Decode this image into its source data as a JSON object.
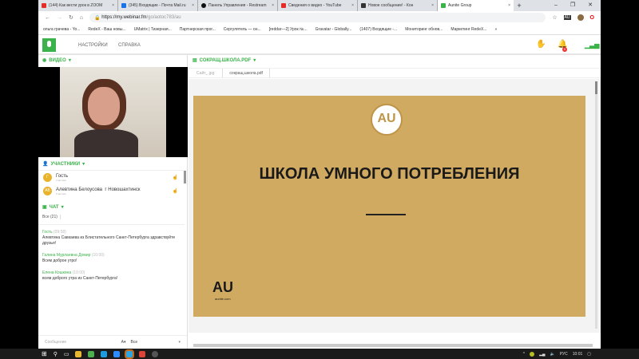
{
  "browser": {
    "tabs": [
      {
        "label": "(144) Как вести урок в ZOOM",
        "color": "#e52d27"
      },
      {
        "label": "(345) Входящие - Почта Mail.ru",
        "color": "#1a73e8"
      },
      {
        "label": "Панель Управления - Restream",
        "color": "#111111"
      },
      {
        "label": "Сведения о видео - YouTube",
        "color": "#e52d27"
      },
      {
        "label": "Новое сообщение! - Кон",
        "color": "#333333"
      },
      {
        "label": "Aunite Group",
        "color": "#3bb34a"
      }
    ],
    "url_host": "https://my.webinar.fm",
    "url_path": "/go/aotoc783/au",
    "bookmarks": [
      "ольга грачева - Yo...",
      "RedeX - Ваш новы...",
      "UMatrix | Тизерная...",
      "Партнерская прог...",
      "Сергулятель — он...",
      "[reddar—2] Урок №...",
      "Gravatar - Globally...",
      "(1407) Входящие -...",
      "Мониторинг обнов...",
      "Маркетинг RedeX..."
    ]
  },
  "app": {
    "menu": [
      "НАСТРОЙКИ",
      "СПРАВКА"
    ],
    "notification_count": "0"
  },
  "video": {
    "label": "ВИДЕО"
  },
  "participants": {
    "label": "УЧАСТНИКИ",
    "items": [
      {
        "initial": "Г",
        "name": "Гость",
        "role": "Участник",
        "city": ""
      },
      {
        "initial": "АБ",
        "name": "Алевтина Белоусова",
        "role": "Участник",
        "city": "г Новошахтинск"
      }
    ]
  },
  "chat": {
    "label": "ЧАТ",
    "filter": "Все (21)",
    "messages": [
      {
        "name": "Гость",
        "time": "(09:58)",
        "text": "Алевтина Савкаева из Блистательного Санкт-Петербурга здравствуйте друзья!"
      },
      {
        "name": "Галина Мурлаевна Домир",
        "time": "(10:00)",
        "text": "Всем доброе утро!"
      },
      {
        "name": "Елена Кошкина",
        "time": "(10:00)",
        "text": "всем доброго утра из Санкт-Петербурга!"
      }
    ],
    "input_placeholder": "Сообщение",
    "recipient": "Все"
  },
  "document": {
    "label": "СОКРАЩ.ШКОЛА.PDF",
    "tabs": [
      "Сайт_.jpg",
      "сокращ.школа.pdf"
    ],
    "slide_title": "ШКОЛА УМНОГО ПОТРЕБЛЕНИЯ",
    "logo_text": "AU",
    "logo_sub": "aunite.com"
  },
  "taskbar": {
    "lang": "РУС",
    "time": "10:01"
  }
}
